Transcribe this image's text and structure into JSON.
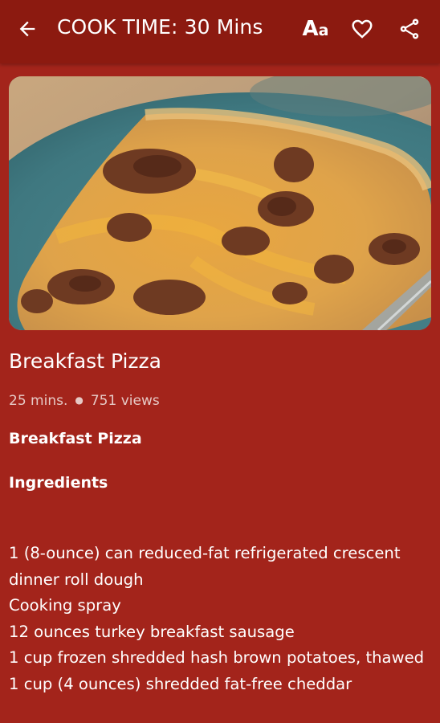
{
  "appbar": {
    "title": "COOK TIME: 30 Mins",
    "font_button": {
      "big": "A",
      "small": "a"
    },
    "icons": [
      "arrow-left-icon",
      "text-size-icon",
      "heart-outline-icon",
      "share-icon"
    ]
  },
  "colors": {
    "appbar_bg": "#8c1a10",
    "page_bg": "#a3241b",
    "text": "#ffffff",
    "meta_text": "#e6c9c5"
  },
  "recipe": {
    "title": "Breakfast Pizza",
    "time": "25 mins.",
    "views": "751 views",
    "subtitle": "Breakfast Pizza",
    "ingredients_heading": "Ingredients",
    "ingredients": [
      "1 (8-ounce) can reduced-fat refrigerated crescent dinner roll dough",
      "Cooking spray",
      "12 ounces turkey breakfast sausage",
      "1 cup frozen shredded hash brown potatoes, thawed",
      "1 cup (4 ounces) shredded fat-free cheddar"
    ]
  }
}
